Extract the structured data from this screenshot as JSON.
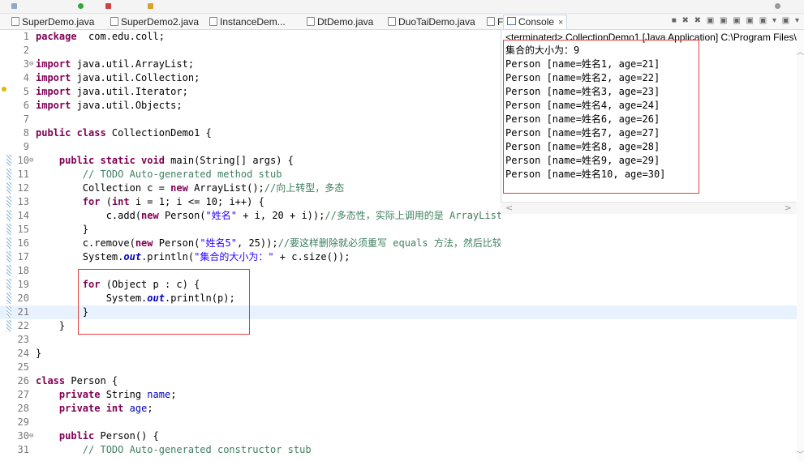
{
  "tabs": [
    {
      "label": "SuperDemo.java"
    },
    {
      "label": "SuperDemo2.java"
    },
    {
      "label": "InstanceDem..."
    },
    {
      "label": "DtDemo.java"
    },
    {
      "label": "DuoTaiDemo.java"
    },
    {
      "label": "F"
    }
  ],
  "console_tab": {
    "label": "Console",
    "close": "×"
  },
  "console": {
    "header": "<terminated> CollectionDemo1 [Java Application] C:\\Program Files\\",
    "lines": [
      "集合的大小为：9",
      "Person [name=姓名1, age=21]",
      "Person [name=姓名2, age=22]",
      "Person [name=姓名3, age=23]",
      "Person [name=姓名4, age=24]",
      "Person [name=姓名6, age=26]",
      "Person [name=姓名7, age=27]",
      "Person [name=姓名8, age=28]",
      "Person [name=姓名9, age=29]",
      "Person [name=姓名10, age=30]"
    ]
  },
  "editor": {
    "lines": [
      {
        "n": "1",
        "t": [
          [
            "kw",
            "package"
          ],
          [
            "",
            "  com.edu.coll;"
          ]
        ]
      },
      {
        "n": "2",
        "t": []
      },
      {
        "n": "3",
        "t": [
          [
            "kw",
            "import"
          ],
          [
            "",
            " java.util.ArrayList;"
          ]
        ]
      },
      {
        "n": "4",
        "t": [
          [
            "kw",
            "import"
          ],
          [
            "",
            " java.util.Collection;"
          ]
        ]
      },
      {
        "n": "5",
        "t": [
          [
            "kw",
            "import"
          ],
          [
            "",
            " java.util.Iterator;"
          ]
        ]
      },
      {
        "n": "6",
        "t": [
          [
            "kw",
            "import"
          ],
          [
            "",
            " java.util.Objects;"
          ]
        ]
      },
      {
        "n": "7",
        "t": []
      },
      {
        "n": "8",
        "t": [
          [
            "kw",
            "public class"
          ],
          [
            "",
            " CollectionDemo1 {"
          ]
        ]
      },
      {
        "n": "9",
        "t": []
      },
      {
        "n": "10",
        "t": [
          [
            "",
            "    "
          ],
          [
            "kw",
            "public static void"
          ],
          [
            "",
            " main(String[] args) {"
          ]
        ]
      },
      {
        "n": "11",
        "t": [
          [
            "cm",
            "        // TODO Auto-generated method stub"
          ]
        ]
      },
      {
        "n": "12",
        "t": [
          [
            "",
            "        Collection c = "
          ],
          [
            "kw",
            "new"
          ],
          [
            "",
            " ArrayList();"
          ],
          [
            "cm",
            "//向上转型，多态"
          ]
        ]
      },
      {
        "n": "13",
        "t": [
          [
            "",
            "        "
          ],
          [
            "kw",
            "for"
          ],
          [
            "",
            " ("
          ],
          [
            "kw",
            "int"
          ],
          [
            "",
            " i = 1; i <= 10; i++) {"
          ]
        ]
      },
      {
        "n": "14",
        "t": [
          [
            "",
            "            c.add("
          ],
          [
            "kw",
            "new"
          ],
          [
            "",
            " Person("
          ],
          [
            "str",
            "\"姓名\""
          ],
          [
            "",
            " + i, 20 + i));"
          ],
          [
            "cm",
            "//多态性，实际上调用的是 ArrayList 的 add() 方法"
          ]
        ]
      },
      {
        "n": "15",
        "t": [
          [
            "",
            "        }"
          ]
        ]
      },
      {
        "n": "16",
        "t": [
          [
            "",
            "        c.remove("
          ],
          [
            "kw",
            "new"
          ],
          [
            "",
            " Person("
          ],
          [
            "str",
            "\"姓名5\""
          ],
          [
            "",
            ", 25));"
          ],
          [
            "cm",
            "//要这样删除就必须重写 equals 方法，然后比较内容是否相等"
          ]
        ]
      },
      {
        "n": "17",
        "t": [
          [
            "",
            "        System."
          ],
          [
            "it",
            "out"
          ],
          [
            "",
            ".println("
          ],
          [
            "str",
            "\"集合的大小为：\""
          ],
          [
            "",
            " + c.size());"
          ]
        ]
      },
      {
        "n": "18",
        "t": []
      },
      {
        "n": "19",
        "t": [
          [
            "",
            "        "
          ],
          [
            "kw",
            "for"
          ],
          [
            "",
            " (Object p : c) {"
          ]
        ]
      },
      {
        "n": "20",
        "t": [
          [
            "",
            "            System."
          ],
          [
            "it",
            "out"
          ],
          [
            "",
            ".println(p);"
          ]
        ]
      },
      {
        "n": "21",
        "t": [
          [
            "",
            "        }"
          ]
        ]
      },
      {
        "n": "22",
        "t": [
          [
            "",
            "    }"
          ]
        ]
      },
      {
        "n": "23",
        "t": []
      },
      {
        "n": "24",
        "t": [
          [
            "",
            "}"
          ]
        ]
      },
      {
        "n": "25",
        "t": []
      },
      {
        "n": "26",
        "t": [
          [
            "kw",
            "class"
          ],
          [
            "",
            " Person {"
          ]
        ]
      },
      {
        "n": "27",
        "t": [
          [
            "",
            "    "
          ],
          [
            "kw",
            "private"
          ],
          [
            "",
            " String "
          ],
          [
            "fld",
            "name"
          ],
          [
            "",
            ";"
          ]
        ]
      },
      {
        "n": "28",
        "t": [
          [
            "",
            "    "
          ],
          [
            "kw",
            "private int"
          ],
          [
            "",
            " "
          ],
          [
            "fld",
            "age"
          ],
          [
            "",
            ";"
          ]
        ]
      },
      {
        "n": "29",
        "t": []
      },
      {
        "n": "30",
        "t": [
          [
            "",
            "    "
          ],
          [
            "kw",
            "public"
          ],
          [
            "",
            " Person() {"
          ]
        ]
      },
      {
        "n": "31",
        "t": [
          [
            "cm",
            "        // TODO Auto-generated constructor stub"
          ]
        ]
      }
    ]
  },
  "colors": {
    "keyword": "#7f0055",
    "string": "#2a00ff",
    "comment": "#3f7f5f",
    "highlight": "#e8f2fe",
    "annotation_box": "#e04040"
  }
}
